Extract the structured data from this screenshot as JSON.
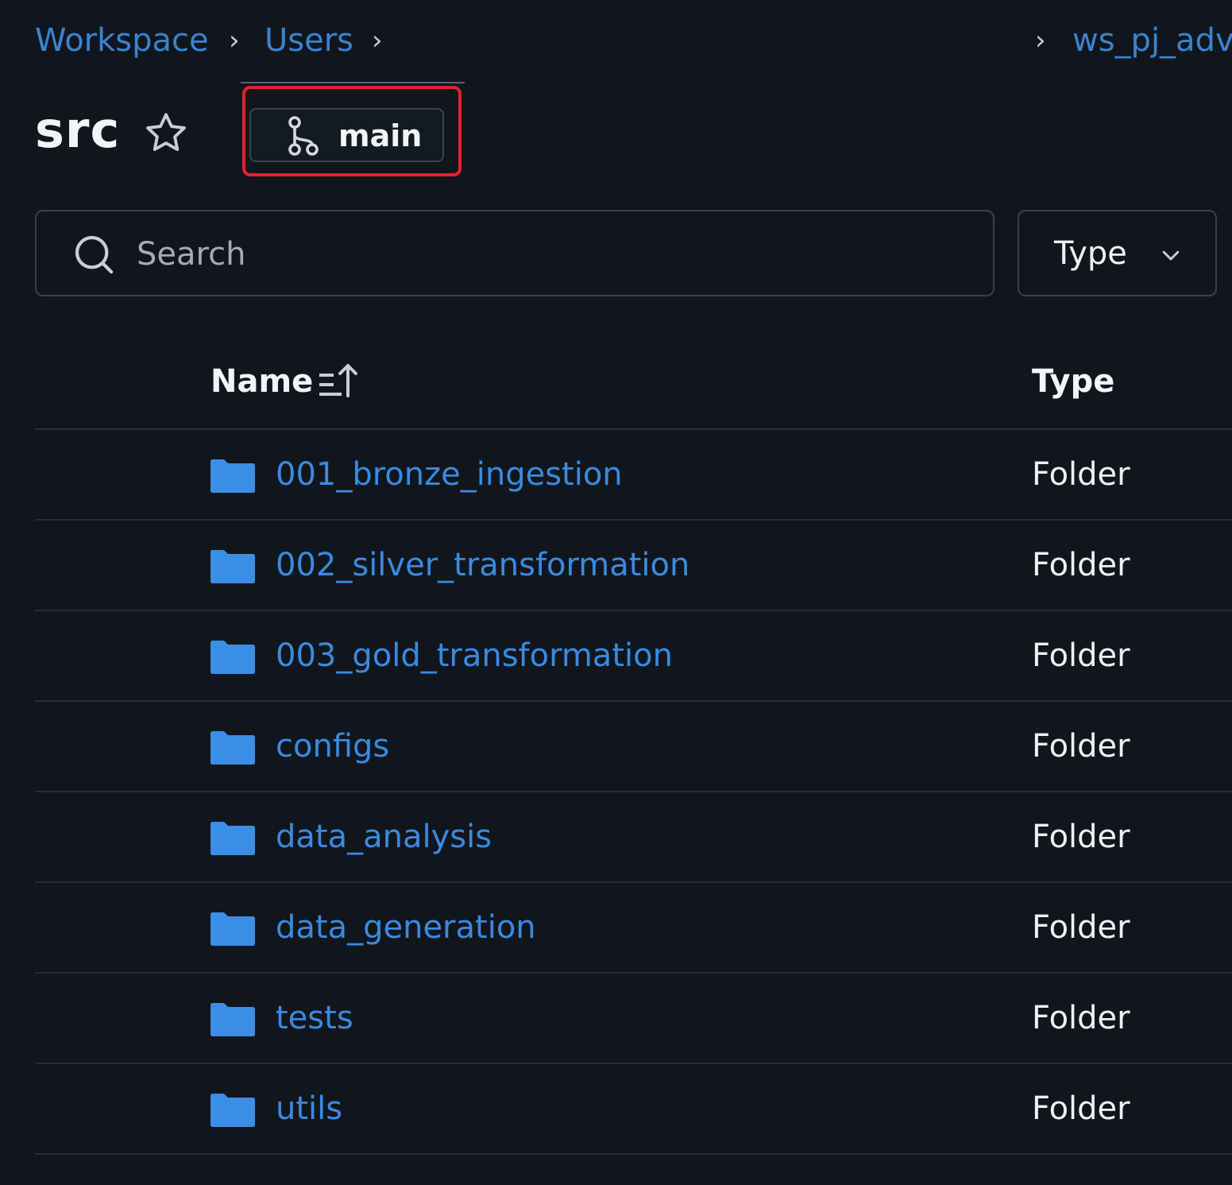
{
  "breadcrumb": {
    "items": [
      "Workspace",
      "Users"
    ],
    "trailing_item": "ws_pj_adv"
  },
  "header": {
    "title": "src",
    "branch": "main"
  },
  "search": {
    "placeholder": "Search"
  },
  "filter": {
    "type_label": "Type"
  },
  "table": {
    "columns": {
      "name": "Name",
      "type": "Type"
    },
    "rows": [
      {
        "name": "001_bronze_ingestion",
        "type": "Folder"
      },
      {
        "name": "002_silver_transformation",
        "type": "Folder"
      },
      {
        "name": "003_gold_transformation",
        "type": "Folder"
      },
      {
        "name": "configs",
        "type": "Folder"
      },
      {
        "name": "data_analysis",
        "type": "Folder"
      },
      {
        "name": "data_generation",
        "type": "Folder"
      },
      {
        "name": "tests",
        "type": "Folder"
      },
      {
        "name": "utils",
        "type": "Folder"
      }
    ]
  },
  "colors": {
    "background": "#11161d",
    "link": "#3a8ae0",
    "folder_icon": "#3b8ee6",
    "highlight": "#e3222b"
  }
}
